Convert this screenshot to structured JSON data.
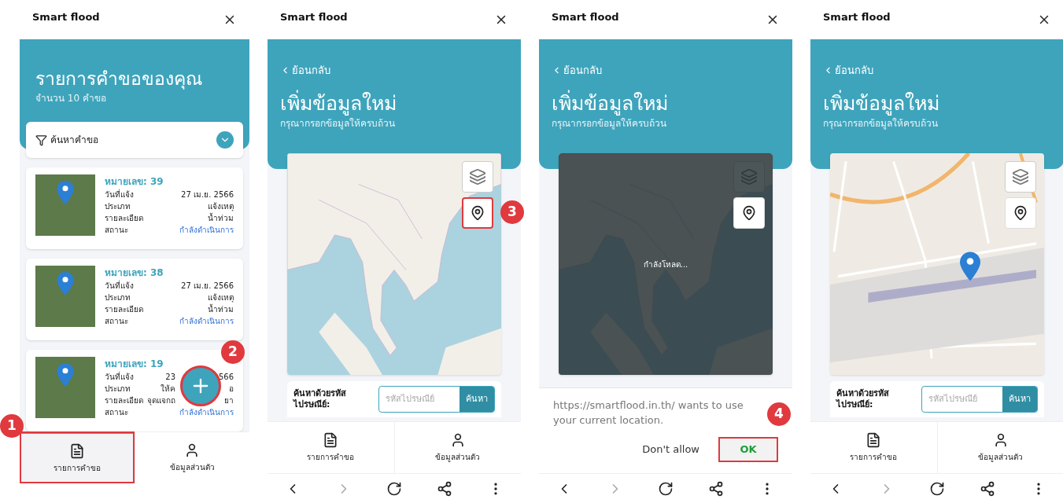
{
  "phones": [
    {
      "kind": "list",
      "app_title": "Smart flood",
      "header": {
        "title": "รายการคำขอของคุณ",
        "subtitle": "จำนวน 10 คำขอ"
      },
      "filter": {
        "label": "ค้นหาคำขอ",
        "expanded": false
      },
      "requests": [
        {
          "number": "หมายเลข: 39",
          "rows": [
            {
              "kind": "plain",
              "label": "วันที่แจ้ง",
              "value": [
                "27 เม.ย. 2566"
              ]
            },
            {
              "kind": "plain",
              "label": "ประเภท",
              "value": [
                "แจ้งเหตุ"
              ]
            },
            {
              "kind": "plain",
              "label": "รายละเอียด",
              "value": [
                "น้ำท่วม"
              ]
            },
            {
              "kind": "status",
              "label": "สถานะ",
              "value": [
                "กำลังดำเนินการ"
              ]
            }
          ]
        },
        {
          "number": "หมายเลข: 38",
          "rows": [
            {
              "kind": "plain",
              "label": "วันที่แจ้ง",
              "value": [
                "27 เม.ย. 2566"
              ]
            },
            {
              "kind": "plain",
              "label": "ประเภท",
              "value": [
                "แจ้งเหตุ"
              ]
            },
            {
              "kind": "plain",
              "label": "รายละเอียด",
              "value": [
                "น้ำท่วม"
              ]
            },
            {
              "kind": "status",
              "label": "สถานะ",
              "value": [
                "กำลังดำเนินการ"
              ]
            }
          ]
        },
        {
          "number": "หมายเลข: 19",
          "rows": [
            {
              "kind": "plain",
              "label": "วันที่แจ้ง",
              "value": [
                "23",
                "566"
              ]
            },
            {
              "kind": "plain",
              "label": "ประเภท",
              "value": [
                "ให้ค",
                "อ"
              ]
            },
            {
              "kind": "plain",
              "label": "รายละเอียด",
              "value": [
                "จุดแจกถ",
                "ยา"
              ]
            },
            {
              "kind": "status",
              "label": "สถานะ",
              "value": [
                "กำลังดำเนินการ"
              ]
            }
          ]
        }
      ],
      "fab": {
        "callout": "2"
      },
      "tabs": [
        {
          "label": "รายการคำขอ",
          "selected": true,
          "callout": "1"
        },
        {
          "label": "ข้อมูลส่วนตัว",
          "selected": false
        }
      ],
      "browser_nav": false
    },
    {
      "kind": "form",
      "app_title": "Smart flood",
      "back": "ย้อนกลับ",
      "header": {
        "title": "เพิ่มข้อมูลใหม่",
        "subtitle": "กรุณากรอกข้อมูลให้ครบถ้วน"
      },
      "map": {
        "kind": "overview",
        "dimmed": false,
        "locate_callout": "3"
      },
      "postcode": {
        "label": "ค้นหาด้วยรหัสไปรษณีย์:",
        "placeholder": "รหัสไปรษณีย์",
        "button": "ค้นหา"
      },
      "tabs": [
        {
          "label": "รายการคำขอ",
          "selected": false
        },
        {
          "label": "ข้อมูลส่วนตัว",
          "selected": false
        }
      ],
      "browser_nav": true
    },
    {
      "kind": "form",
      "app_title": "Smart flood",
      "back": "ย้อนกลับ",
      "header": {
        "title": "เพิ่มข้อมูลใหม่",
        "subtitle": "กรุณากรอกข้อมูลให้ครบถ้วน"
      },
      "map": {
        "kind": "overview",
        "dimmed": true,
        "loading": "กำลังโหลด..."
      },
      "dialog": {
        "message": "https://smartflood.in.th/ wants to use your current location.",
        "deny": "Don't allow",
        "allow": "OK",
        "callout": "4"
      },
      "browser_nav": true
    },
    {
      "kind": "form",
      "app_title": "Smart flood",
      "back": "ย้อนกลับ",
      "header": {
        "title": "เพิ่มข้อมูลใหม่",
        "subtitle": "กรุณากรอกข้อมูลให้ครบถ้วน"
      },
      "map": {
        "kind": "street",
        "dimmed": false
      },
      "postcode": {
        "label": "ค้นหาด้วยรหัสไปรษณีย์:",
        "placeholder": "รหัสไปรษณีย์",
        "button": "ค้นหา"
      },
      "tabs": [
        {
          "label": "รายการคำขอ",
          "selected": false
        },
        {
          "label": "ข้อมูลส่วนตัว",
          "selected": false
        }
      ],
      "browser_nav": true
    }
  ]
}
